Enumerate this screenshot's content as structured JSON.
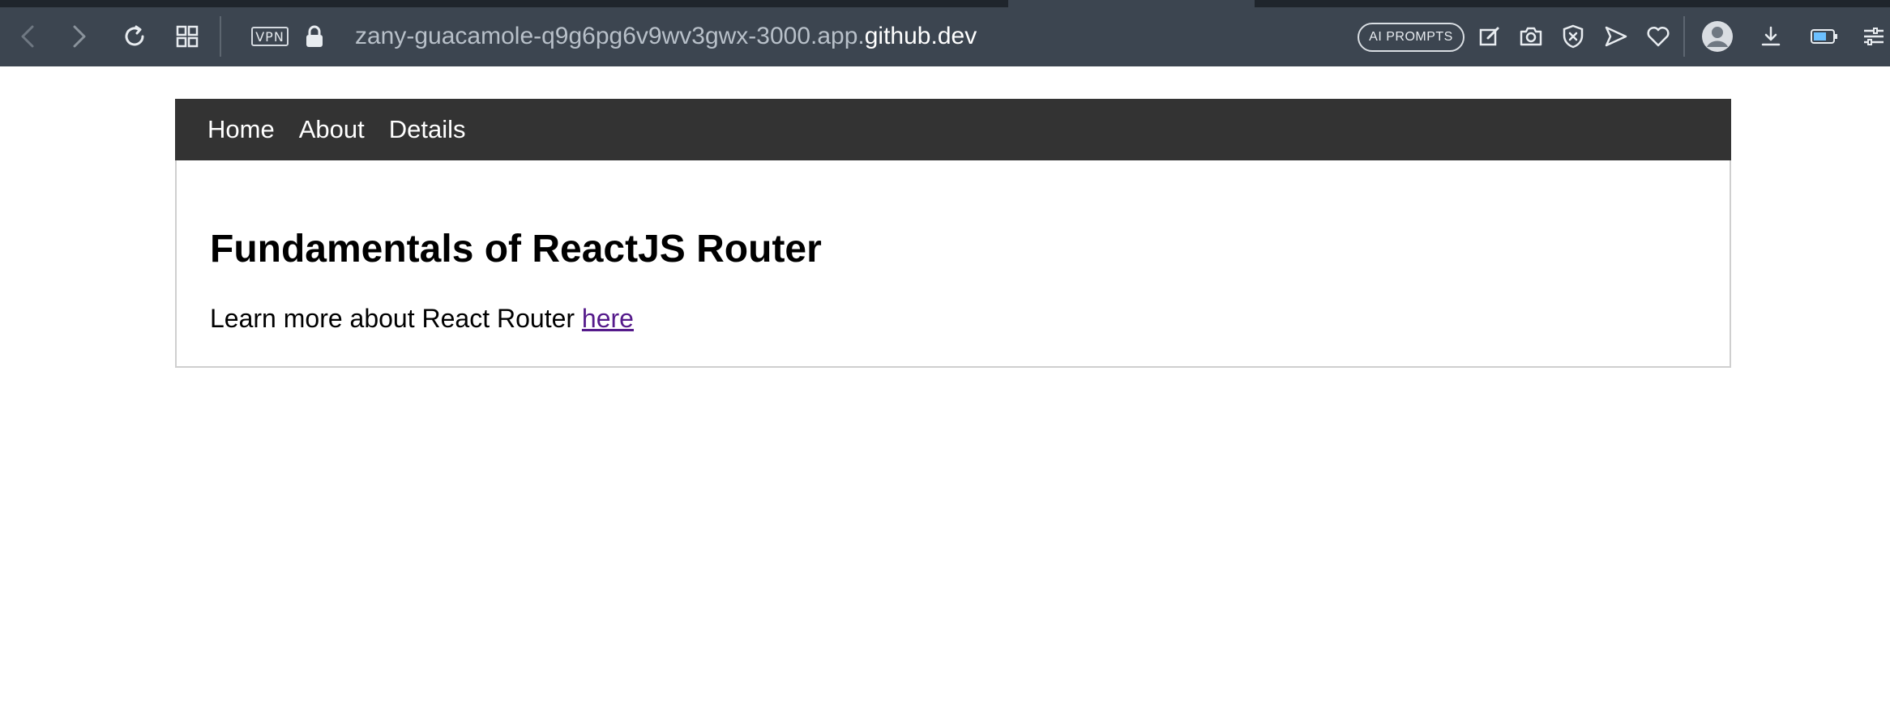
{
  "browser": {
    "vpn_label": "VPN",
    "url": {
      "prefix": "zany-guacamole-q9g6pg6v9wv3gwx-3000.app.",
      "domain": "github.dev"
    },
    "ai_prompts_label": "AI PROMPTS",
    "icons": [
      "back-icon",
      "forward-icon",
      "reload-icon",
      "tab-grid-icon",
      "lock-icon",
      "snapshot-edit-icon",
      "camera-icon",
      "adblock-icon",
      "send-icon",
      "heart-icon",
      "profile-avatar-icon",
      "download-icon",
      "battery-icon",
      "settings-sliders-icon"
    ]
  },
  "nav": {
    "items": [
      {
        "label": "Home"
      },
      {
        "label": "About"
      },
      {
        "label": "Details"
      }
    ]
  },
  "main": {
    "title": "Fundamentals of ReactJS Router",
    "text_before_link": "Learn more about React Router ",
    "link_text": "here"
  },
  "colors": {
    "chrome_bg": "#3c4550",
    "nav_bg": "#333333",
    "visited_link": "#551a8b"
  }
}
